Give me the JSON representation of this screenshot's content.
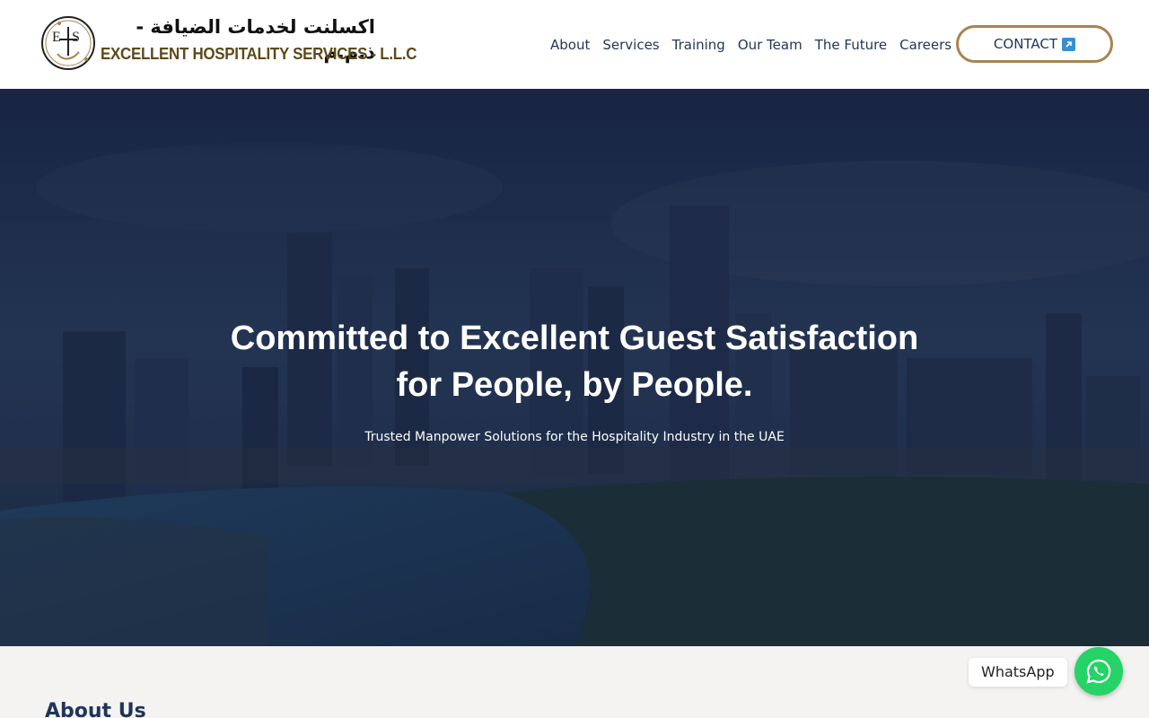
{
  "brand": {
    "name_ar": "اكسلنت لخدمات الضيافة - ذ.م.م",
    "name_en": "EXCELLENT HOSPITALITY SERVICES - L.L.C",
    "mark": "EHS",
    "logo_icon": "ehs-monogram-icon",
    "accent_color": "#a98350",
    "name_color": "#5c4a1c"
  },
  "nav": {
    "items": [
      {
        "label": "About"
      },
      {
        "label": "Services"
      },
      {
        "label": "Training"
      },
      {
        "label": "Our Team"
      },
      {
        "label": "The Future"
      },
      {
        "label": "Careers"
      }
    ],
    "text_color": "#1f3557"
  },
  "contact": {
    "label": "CONTACT",
    "icon": "external-link-icon",
    "border_color": "#a98350"
  },
  "hero": {
    "title_line1": "Committed to Excellent Guest Satisfaction",
    "title_line2": "for People, by People.",
    "subtitle": "Trusted Manpower Solutions for the Hospitality Industry in the UAE",
    "overlay_color": "#1a2848"
  },
  "about": {
    "title": "About Us",
    "background": "#f4f3f1"
  },
  "whatsapp": {
    "label": "WhatsApp",
    "icon": "whatsapp-icon",
    "color": "#25d366"
  }
}
